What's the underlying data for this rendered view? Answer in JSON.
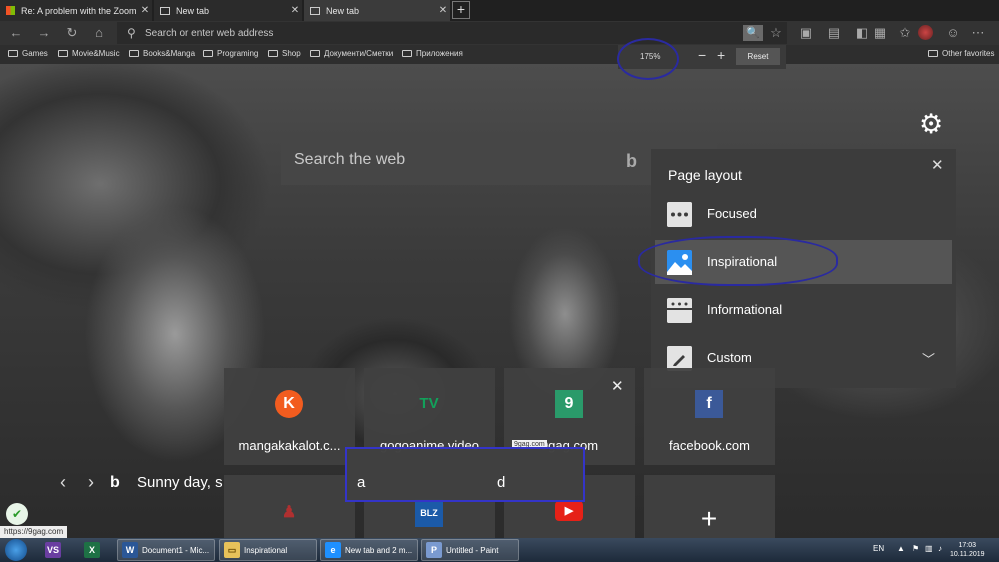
{
  "browser": {
    "tabs": [
      {
        "title": "Re: A problem with the Zoom le..."
      },
      {
        "title": "New tab"
      },
      {
        "title": "New tab"
      }
    ],
    "address_placeholder": "Search or enter web address",
    "favorites": [
      "Games",
      "Movie&Music",
      "Books&Manga",
      "Programing",
      "Shop",
      "Документи/Сметки",
      "Приложения"
    ],
    "other_favorites": "Other favorites",
    "zoom": {
      "level": "175%",
      "minus": "−",
      "plus": "+",
      "reset": "Reset"
    }
  },
  "newtab": {
    "search_placeholder": "Search the web",
    "page_layout": {
      "title": "Page layout",
      "options": [
        {
          "label": "Focused",
          "icon": "focused-layout-icon"
        },
        {
          "label": "Inspirational",
          "icon": "inspirational-layout-icon",
          "selected": true
        },
        {
          "label": "Informational",
          "icon": "informational-layout-icon"
        },
        {
          "label": "Custom",
          "icon": "custom-layout-icon"
        }
      ]
    },
    "tiles_row1": [
      {
        "label": "mangakakalot.c...",
        "logo": "K",
        "color": "#f25c1f"
      },
      {
        "label": "gogoanime.video",
        "logo": "TV",
        "color": "#12a05a"
      },
      {
        "label": "9gag.com",
        "logo": "9",
        "color": "#2a9a6a"
      },
      {
        "label": "facebook.com",
        "logo": "f",
        "color": "#3b5998"
      }
    ],
    "tiles_row2": [
      {
        "logo": "♟",
        "color": "#b03030"
      },
      {
        "logo": "BLZ",
        "color": "#1b5aa8"
      },
      {
        "logo": "▶",
        "color": "#e62117"
      },
      {
        "logo": "+",
        "color": "transparent"
      }
    ],
    "tile_tooltip": "9gag.com",
    "weather_text": "Sunny day, s",
    "annotation_letters": [
      "a",
      "d"
    ],
    "status_url": "https://9gag.com"
  },
  "taskbar": {
    "apps": [
      {
        "label": "Document1 - Mic...",
        "icon": "W",
        "color": "#2b5797"
      },
      {
        "label": "Inspirational",
        "icon": "📁",
        "color": "#e8c25a"
      },
      {
        "label": "New tab and 2 m...",
        "icon": "e",
        "color": "#1e90ff"
      },
      {
        "label": "Untitled - Paint",
        "icon": "P",
        "color": "#7a9ad0"
      }
    ],
    "lang": "EN",
    "time": "17:03",
    "date": "10.11.2019"
  }
}
